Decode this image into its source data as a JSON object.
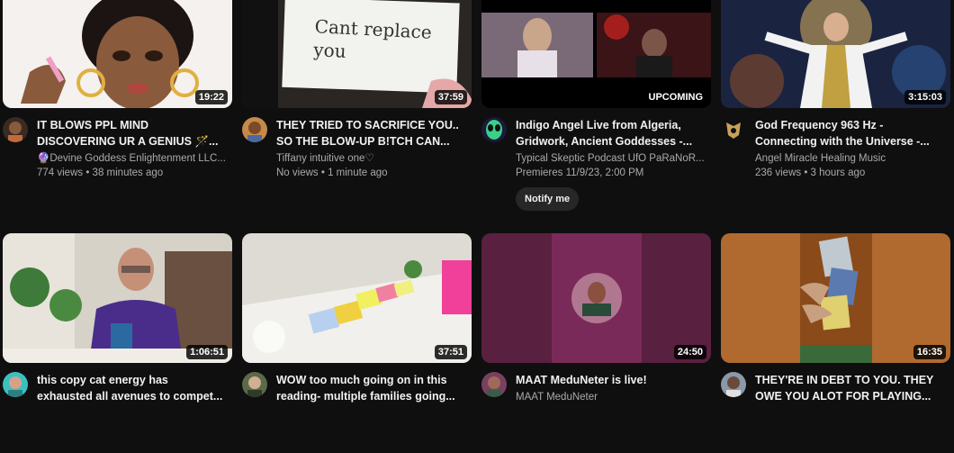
{
  "videos": [
    {
      "title": "IT BLOWS PPL MIND DISCOVERING UR A GENIUS 🪄...",
      "channel": "🔮Devine Goddess Enlightenment LLC...",
      "stats": "774 views • 38 minutes ago",
      "duration": "19:22"
    },
    {
      "title": "THEY TRIED TO SACRIFICE YOU.. SO THE BLOW-UP B!TCH CAN...",
      "channel": "Tiffany intuitive one♡",
      "stats": "No views • 1 minute ago",
      "duration": "37:59",
      "thumb_text": "Cant replace you"
    },
    {
      "title": "Indigo Angel Live from Algeria, Gridwork, Ancient Goddesses -...",
      "channel": "Typical Skeptic Podcast UfO PaRaNoR...",
      "stats": "Premieres 11/9/23, 2:00 PM",
      "badge": "UPCOMING",
      "notify_label": "Notify me"
    },
    {
      "title": "God Frequency 963 Hz - Connecting with the Universe -...",
      "channel": "Angel Miracle Healing Music",
      "stats": "236 views • 3 hours ago",
      "duration": "3:15:03"
    },
    {
      "title": "this copy cat energy has exhausted all avenues to compet...",
      "channel": "",
      "stats": "",
      "duration": "1:06:51"
    },
    {
      "title": "WOW too much going on in this reading- multiple families going...",
      "channel": "",
      "stats": "",
      "duration": "37:51"
    },
    {
      "title": "MAAT MeduNeter is live!",
      "channel": "MAAT MeduNeter",
      "stats": "",
      "duration": "24:50"
    },
    {
      "title": "THEY'RE IN DEBT TO YOU. THEY OWE YOU ALOT FOR PLAYING...",
      "channel": "",
      "stats": "",
      "duration": "16:35"
    }
  ]
}
